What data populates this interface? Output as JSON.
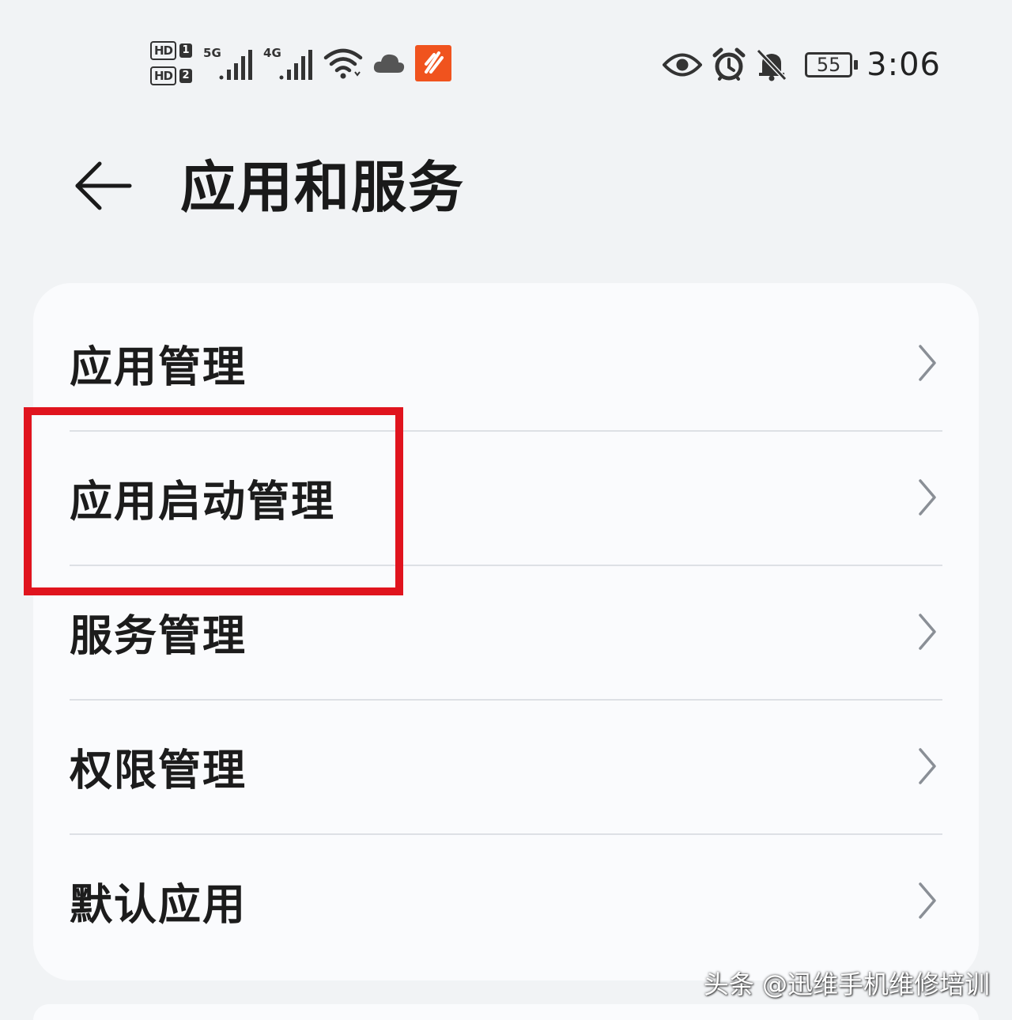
{
  "status_bar": {
    "sim1_label": "HD",
    "sim1_num": "1",
    "sim2_label": "HD",
    "sim2_num": "2",
    "network1": "5G",
    "network2": "4G",
    "battery": "55",
    "time": "3:06",
    "icons": [
      "signal-icon",
      "wifi-icon",
      "cloud-icon",
      "app-notification-icon",
      "eye-icon",
      "alarm-icon",
      "mute-bell-icon",
      "battery-icon"
    ],
    "notification_color": "#f0531e"
  },
  "header": {
    "title": "应用和服务"
  },
  "menu": {
    "items": [
      {
        "label": "应用管理"
      },
      {
        "label": "应用启动管理"
      },
      {
        "label": "服务管理"
      },
      {
        "label": "权限管理"
      },
      {
        "label": "默认应用"
      }
    ]
  },
  "highlight_color": "#e0141e",
  "watermark": "头条 @迅维手机维修培训"
}
